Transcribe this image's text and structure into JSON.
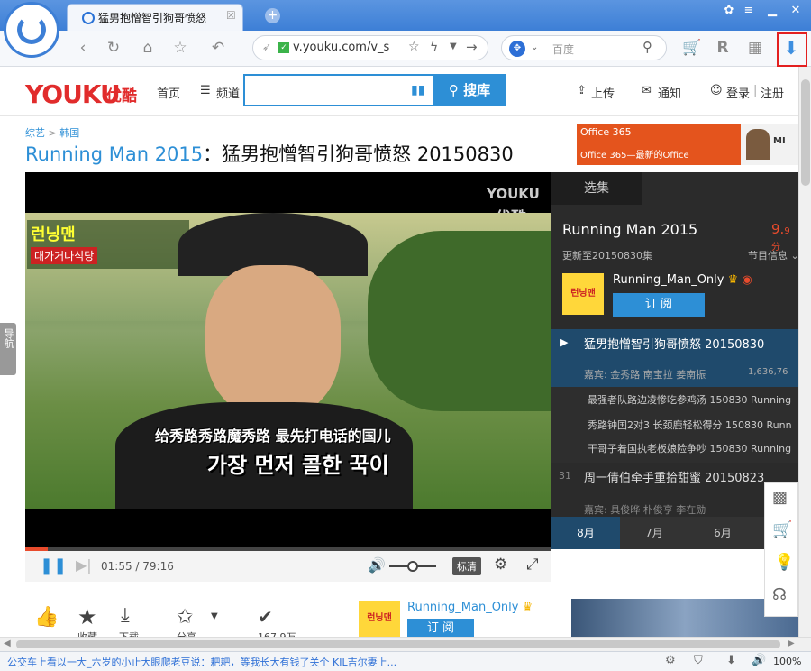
{
  "browser": {
    "tab_title": "猛男抱憎智引狗哥愤怒",
    "tab_close": "☒",
    "url": "v.youku.com/v_s",
    "search_placeholder": "百度",
    "new_tab": "+"
  },
  "header": {
    "logo": "YOUKU",
    "logo_cn": "优酷",
    "home": "首页",
    "channel": "频道",
    "search_button": "搜库",
    "upload": "上传",
    "notify": "通知",
    "login": "登录",
    "sep": "|",
    "register": "注册"
  },
  "video": {
    "crumb_1": "综艺",
    "crumb_sep": ">",
    "crumb_2": "韩国",
    "title_main": "Running Man 2015",
    "title_rest": "：猛男抱憎智引狗哥愤怒 20150830",
    "watermark_1": "YOUKU",
    "watermark_2": "优酷",
    "subtitle_cn": "给秀路秀路魔秀路 最先打电话的国儿",
    "subtitle_kr": "가장 먼저 콜한 꾹이",
    "overlay_top": "런닝맨",
    "overlay_ad": "대가거나식당",
    "time": "01:55 / 79:16",
    "quality": "标清"
  },
  "ad": {
    "line1": "Office 365",
    "line2": "Office 365",
    "line2b": "—最新的Office",
    "brand": "MI"
  },
  "panel": {
    "tab": "选集",
    "show_title": "Running Man 2015",
    "score_main": "9.",
    "score_sub": "9分",
    "updated": "更新至20150830集",
    "info": "节目信息",
    "channel_name": "Running_Man_Only",
    "subscribe": "订 阅",
    "ep_current": "猛男抱憎智引狗哥愤怒 20150830",
    "ep_current_guests": "嘉宾: 金秀路  南宝拉  姜南振",
    "ep_current_views": "1,636,76",
    "clips": [
      "最强者队路边凌惨吃参鸡汤 150830 Running",
      "秀路钟国2对3 长颈鹿轻松得分 150830 Runn",
      "干哥子着国执老板娘险争吵 150830 Running"
    ],
    "ep_prev_num": "31",
    "ep_prev": "周一倩伯牵手重拾甜蜜 20150823",
    "ep_prev_guests": "嘉宾: 具俊晔  朴俊亨  李在勋",
    "months": [
      "8月",
      "7月",
      "6月"
    ]
  },
  "bottom": {
    "like": "",
    "favorite": "收藏",
    "download": "下载",
    "share": "分享",
    "views": "167.9万",
    "channel": "Running_Man_Only",
    "subscribe": "订 阅"
  },
  "nav_tab": "导航",
  "status": {
    "news": "公交车上看以一大_六岁的小止大眼爬老豆说：耙耙，等我长大有钱了关个 KIL吉尔妻上...",
    "zoom": "100%"
  },
  "colors": {
    "accent": "#2d8fd6",
    "brand": "#e12c2c",
    "browser": "#3d7fd6"
  }
}
